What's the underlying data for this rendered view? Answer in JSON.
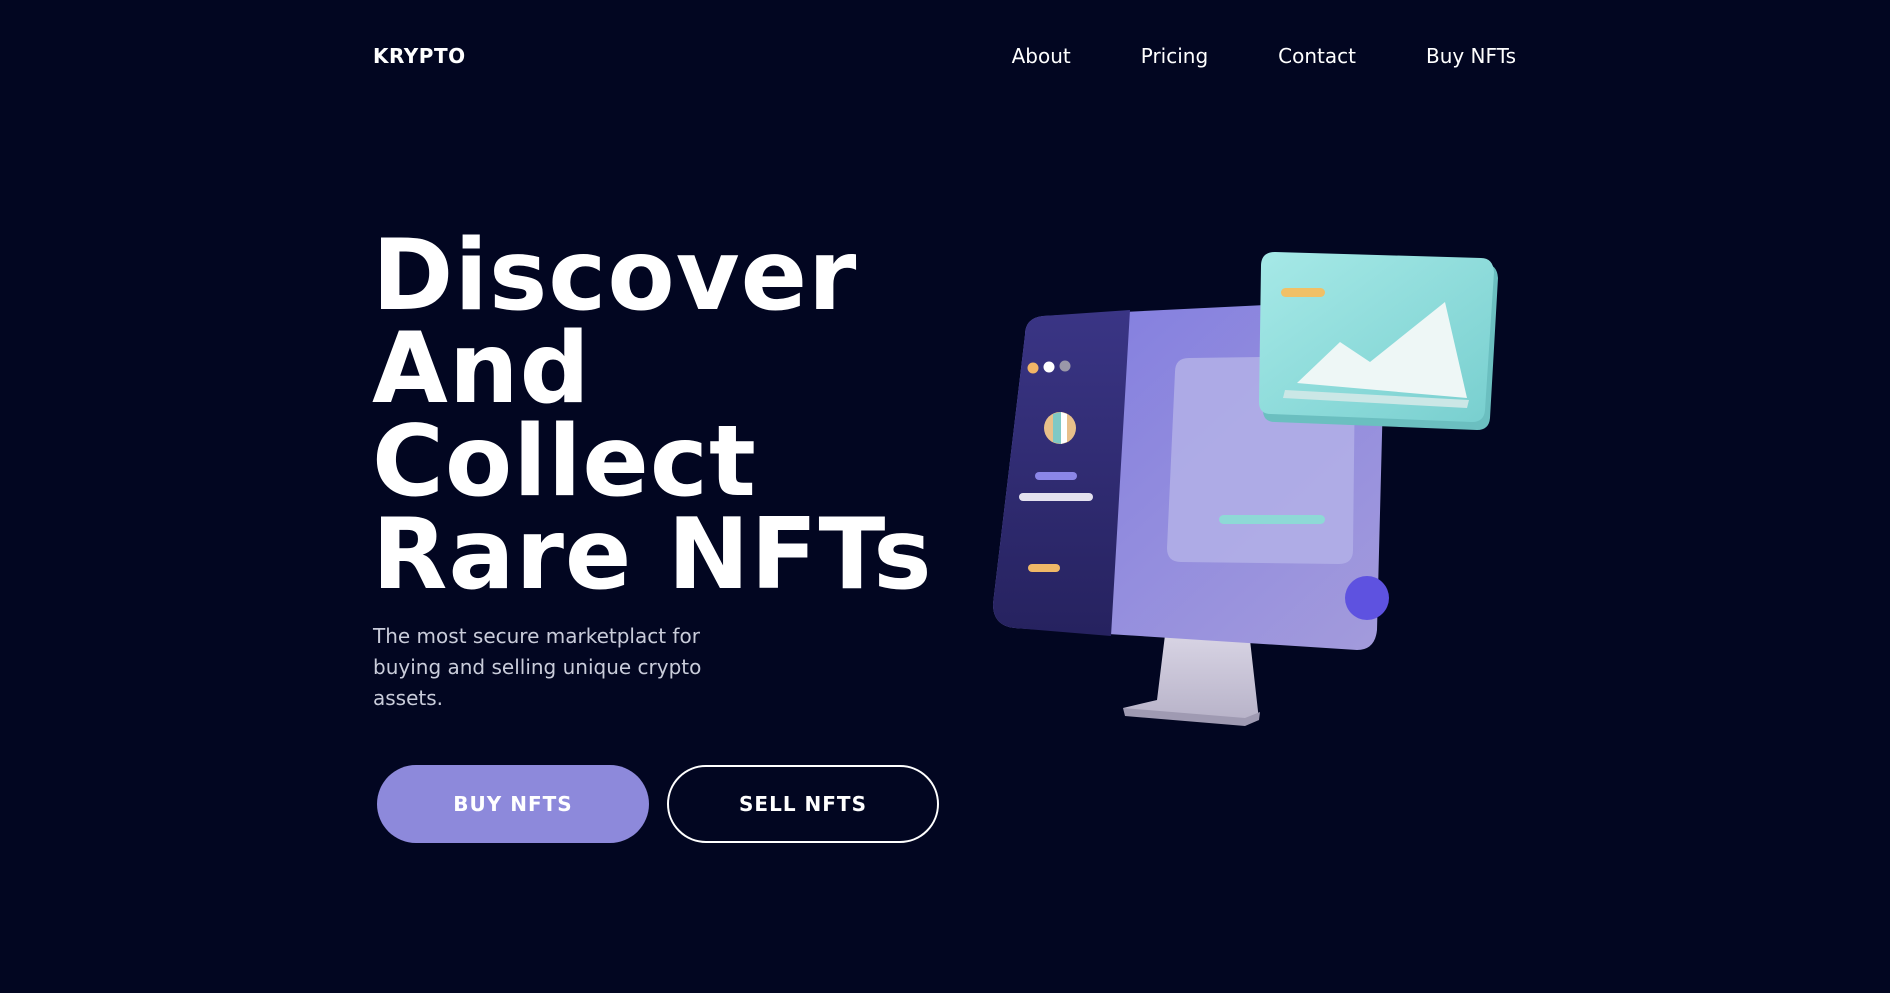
{
  "header": {
    "logo": "KRYPTO",
    "nav": {
      "about": "About",
      "pricing": "Pricing",
      "contact": "Contact",
      "buy_nfts": "Buy NFTs"
    }
  },
  "hero": {
    "title_lines": [
      "Discover",
      "And",
      "Collect",
      "Rare NFTs"
    ],
    "subtitle": "The most secure marketplact for buying and selling unique crypto assets.",
    "buy_button": "BUY NFTS",
    "sell_button": "SELL NFTS"
  },
  "colors": {
    "background": "#020621",
    "accent": "#8d89db",
    "teal": "#93dcdc"
  },
  "illustration": {
    "icon": "computer-monitor-nft-illustration"
  }
}
